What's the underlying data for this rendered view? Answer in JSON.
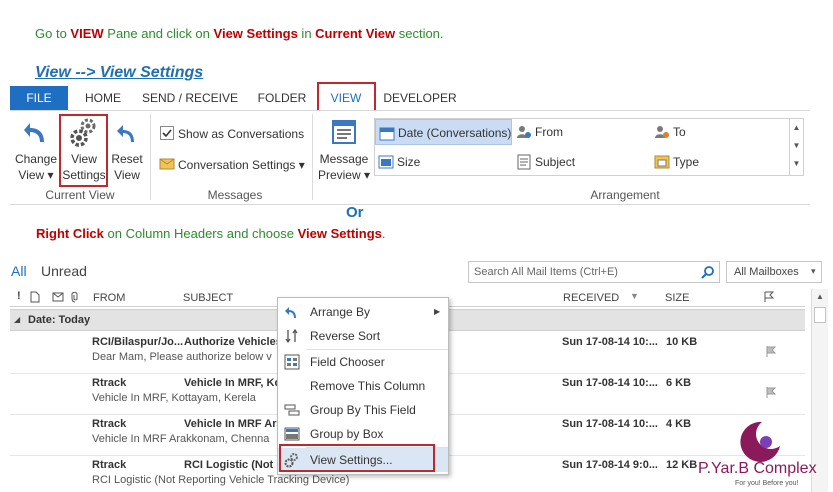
{
  "instructions": {
    "line1_parts": [
      "Go to ",
      "VIEW",
      " Pane and click on ",
      "View Settings",
      " in ",
      "Current View",
      " section."
    ],
    "heading": "View --> View Settings",
    "or_text": "Or",
    "line2_parts": [
      "Right Click",
      " on Column Headers and choose ",
      "View Settings",
      "."
    ]
  },
  "ribbon": {
    "tabs": [
      "FILE",
      "HOME",
      "SEND / RECEIVE",
      "FOLDER",
      "VIEW",
      "DEVELOPER"
    ],
    "current_view": {
      "change_view": [
        "Change",
        "View ▾"
      ],
      "view_settings": [
        "View",
        "Settings"
      ],
      "reset_view": [
        "Reset",
        "View"
      ],
      "group_label": "Current View"
    },
    "messages": {
      "show_as_conversations": "Show as Conversations",
      "conversation_settings": "Conversation Settings ▾",
      "group_label": "Messages"
    },
    "arrangement": {
      "message_preview": [
        "Message",
        "Preview ▾"
      ],
      "items": [
        "Date (Conversations)",
        "From",
        "To",
        "Size",
        "Subject",
        "Type"
      ],
      "group_label": "Arrangement"
    }
  },
  "mail": {
    "filters": [
      "All",
      "Unread"
    ],
    "search_placeholder": "Search All Mail Items (Ctrl+E)",
    "scope": "All Mailboxes",
    "columns": [
      "FROM",
      "SUBJECT",
      "RECEIVED",
      "SIZE"
    ],
    "group_header": "Date: Today",
    "rows": [
      {
        "from": "RCI/Bilaspur/Jo...",
        "subject": "Authorize Vehicles",
        "preview": "Dear Mam,  Please authorize below v",
        "received": "Sun 17-08-14 10:...",
        "size": "10 KB"
      },
      {
        "from": "Rtrack",
        "subject": "Vehicle In MRF, Ko",
        "preview": "Vehicle In MRF, Kottayam, Kerela",
        "received": "Sun 17-08-14 10:...",
        "size": "6 KB"
      },
      {
        "from": "Rtrack",
        "subject": "Vehicle In MRF Ara",
        "preview": "Vehicle In MRF Arakkonam, Chenna",
        "received": "Sun 17-08-14 10:...",
        "size": "4 KB"
      },
      {
        "from": "Rtrack",
        "subject": "RCI Logistic (Not R",
        "preview": "RCI Logistic (Not Reporting Vehicle Tracking Device)",
        "received": "Sun 17-08-14 9:0...",
        "size": "12 KB"
      }
    ]
  },
  "context_menu": {
    "items": [
      "Arrange By",
      "Reverse Sort",
      "Field Chooser",
      "Remove This Column",
      "Group By This Field",
      "Group by Box",
      "View Settings..."
    ]
  },
  "watermark": {
    "name": "P.Yar.B Complex",
    "tagline": "For you! Before you!"
  },
  "colors": {
    "instruction_green": "#2e8b2e",
    "highlight_red": "#c00000",
    "heading_blue": "#1f6fb2",
    "file_tab_blue": "#1e6fc1",
    "selection_blue": "#c9dcf3",
    "callout_red": "#c0282c"
  }
}
